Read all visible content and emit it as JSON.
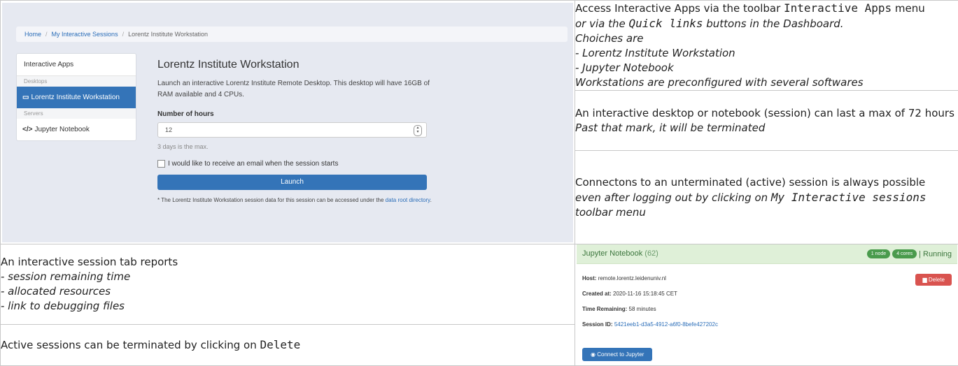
{
  "cell1": {
    "line1_pre": "Access Interactive Apps via the toolbar ",
    "line1_code": "Interactive Apps",
    "line1_post": " menu",
    "line2_pre": "or via the ",
    "line2_code": "Quick links",
    "line2_post": " buttons in the Dashboard.",
    "line3": "Choiches are",
    "line4": "- Lorentz Institute Workstation",
    "line5": "- Jupyter Notebook",
    "line6": "Workstations are preconfigured with several softwares"
  },
  "cell2": {
    "line1": "An interactive desktop or notebook (session) can last a max of 72 hours",
    "line2": "Past that mark, it will be terminated"
  },
  "cell3": {
    "line1": "Connectons to an unterminated (active) session is always possible",
    "line2_pre": "even after logging out by clicking on ",
    "line2_code": "My Interactive sessions",
    "line2_post": " toolbar menu"
  },
  "cell4": {
    "line1": "An interactive session tab reports",
    "line2": "- session remaining time",
    "line3": "- allocated resources",
    "line4": "- link to debugging files"
  },
  "cell5": {
    "pre": "Active sessions can be terminated by clicking on ",
    "code": "Delete"
  },
  "shot1": {
    "breadcrumb": {
      "home": "Home",
      "sessions": "My Interactive Sessions",
      "current": "Lorentz Institute Workstation",
      "separator": "/"
    },
    "sidebar": {
      "header": "Interactive Apps",
      "cat_desktops": "Desktops",
      "item_workstation": "Lorentz Institute Workstation",
      "cat_servers": "Servers",
      "item_jupyter": "Jupyter Notebook"
    },
    "form": {
      "title": "Lorentz Institute Workstation",
      "desc": "Launch an interactive Lorentz Institute Remote Desktop. This desktop will have 16GB of RAM available and 4 CPUs.",
      "hours_label": "Number of hours",
      "hours_value": "12",
      "hours_help": "3 days is the max.",
      "email_label": "I would like to receive an email when the session starts",
      "launch": "Launch",
      "note_pre": "* The Lorentz Institute Workstation session data for this session can be accessed under the ",
      "note_link": "data root directory",
      "note_post": "."
    }
  },
  "shot2": {
    "name": "Jupyter Notebook",
    "count": "(62)",
    "nodes": "1 node",
    "cores": "4 cores",
    "status": "Running",
    "host_label": "Host:",
    "host_value": "remote.lorentz.leidenuniv.nl",
    "created_label": "Created at:",
    "created_value": "2020-11-16 15:18:45 CET",
    "time_label": "Time Remaining:",
    "time_value": "58 minutes",
    "id_label": "Session ID:",
    "id_value": "5421eeb1-d3a5-4912-a6f0-8befe427202c",
    "delete": "Delete",
    "connect": "Connect to Jupyter"
  },
  "icons": {
    "desktop": "monitor-icon",
    "code": "code-icon",
    "trash": "trash-icon",
    "eye": "eye-icon"
  },
  "colors": {
    "primary": "#3474b8",
    "danger": "#d9534f",
    "success_bg": "#dff0d8",
    "success_text": "#3c763d"
  }
}
